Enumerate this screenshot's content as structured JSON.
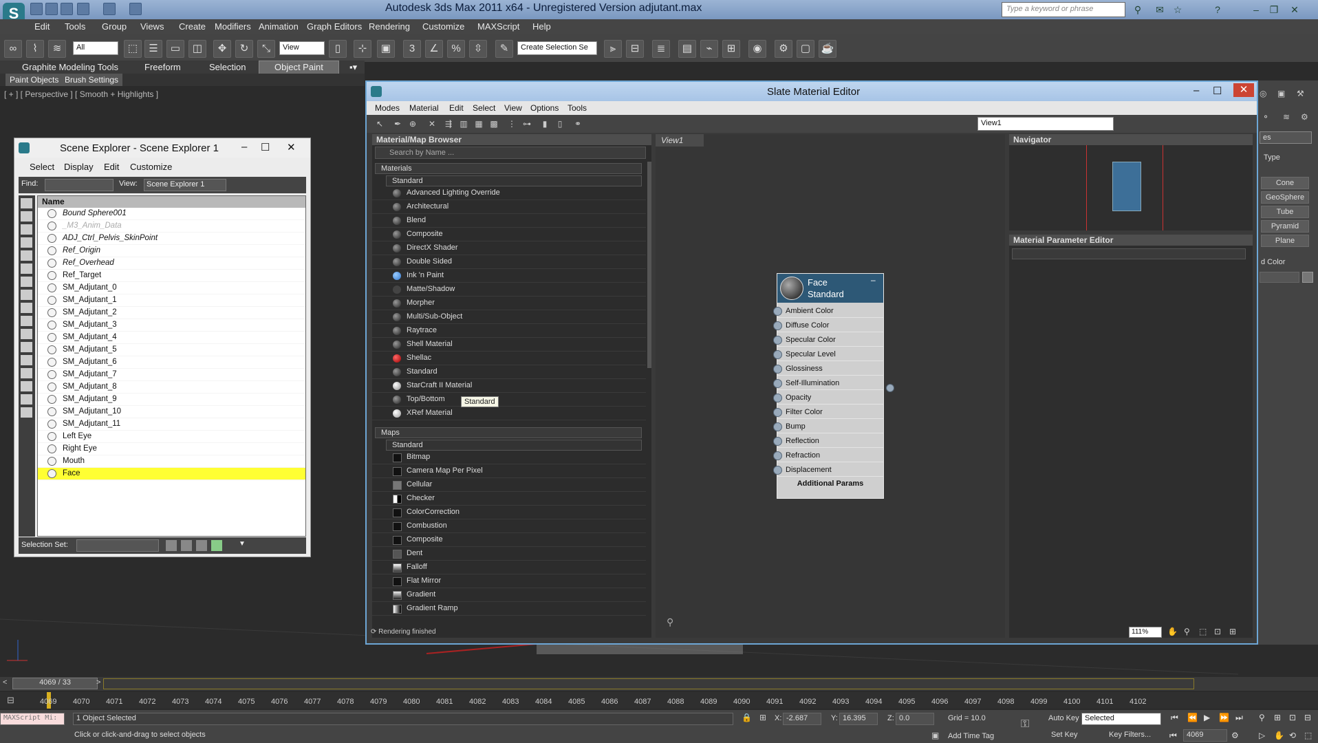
{
  "app": {
    "title": "Autodesk 3ds Max  2011 x64  -  Unregistered Version    adjutant.max",
    "search_placeholder": "Type a keyword or phrase"
  },
  "menu": [
    "Edit",
    "Tools",
    "Group",
    "Views",
    "Create",
    "Modifiers",
    "Animation",
    "Graph Editors",
    "Rendering",
    "Customize",
    "MAXScript",
    "Help"
  ],
  "toolbar": {
    "filter": "All",
    "refcoord": "View",
    "selset": "Create Selection Se"
  },
  "ribbon": {
    "tabs": [
      "Graphite Modeling Tools",
      "Freeform",
      "Selection",
      "Object Paint"
    ],
    "sub": [
      "Paint Objects",
      "Brush Settings"
    ]
  },
  "viewport": {
    "label": "[ + ] [ Perspective ] [ Smooth + Highlights ]"
  },
  "scene": {
    "title": "Scene Explorer - Scene Explorer 1",
    "menu": [
      "Select",
      "Display",
      "Edit",
      "Customize"
    ],
    "find_label": "Find:",
    "view_label": "View:",
    "view_value": "Scene Explorer 1",
    "col_name": "Name",
    "selset_label": "Selection Set:",
    "items": [
      "Bound Sphere001",
      "_M3_Anim_Data",
      "ADJ_Ctrl_Pelvis_SkinPoint",
      "Ref_Origin",
      "Ref_Overhead",
      "Ref_Target",
      "SM_Adjutant_0",
      "SM_Adjutant_1",
      "SM_Adjutant_2",
      "SM_Adjutant_3",
      "SM_Adjutant_4",
      "SM_Adjutant_5",
      "SM_Adjutant_6",
      "SM_Adjutant_7",
      "SM_Adjutant_8",
      "SM_Adjutant_9",
      "SM_Adjutant_10",
      "SM_Adjutant_11",
      "Left Eye",
      "Right Eye",
      "Mouth",
      "Face"
    ]
  },
  "slate": {
    "title": "Slate Material Editor",
    "menu": [
      "Modes",
      "Material",
      "Edit",
      "Select",
      "View",
      "Options",
      "Tools"
    ],
    "view_select": "View1",
    "browser_title": "Material/Map Browser",
    "search": "Search by Name ...",
    "materials_label": "Materials",
    "standard_label": "Standard",
    "maps_label": "Maps",
    "maps_standard_label": "Standard",
    "materials": [
      "Advanced Lighting Override",
      "Architectural",
      "Blend",
      "Composite",
      "DirectX Shader",
      "Double Sided",
      "Ink 'n Paint",
      "Matte/Shadow",
      "Morpher",
      "Multi/Sub-Object",
      "Raytrace",
      "Shell Material",
      "Shellac",
      "Standard",
      "StarCraft II Material",
      "Top/Bottom",
      "XRef Material"
    ],
    "maps": [
      "Bitmap",
      "Camera Map Per Pixel",
      "Cellular",
      "Checker",
      "ColorCorrection",
      "Combustion",
      "Composite",
      "Dent",
      "Falloff",
      "Flat Mirror",
      "Gradient",
      "Gradient Ramp"
    ],
    "tooltip": "Standard",
    "view_tab": "View1",
    "node": {
      "name": "Face",
      "type": "Standard",
      "slots": [
        "Ambient Color",
        "Diffuse Color",
        "Specular Color",
        "Specular Level",
        "Glossiness",
        "Self-Illumination",
        "Opacity",
        "Filter Color",
        "Bump",
        "Reflection",
        "Refraction",
        "Displacement"
      ],
      "footer": "Additional Params"
    },
    "navigator": "Navigator",
    "mpe": "Material Parameter Editor",
    "status": "Rendering finished",
    "zoom": "111%"
  },
  "cmd": {
    "items": [
      "Cone",
      "GeoSphere",
      "Tube",
      "Pyramid",
      "Plane"
    ],
    "type_label": "Type",
    "color_label": "d Color",
    "dropdown": "es"
  },
  "timeline": {
    "frame": "4069 / 33",
    "ticks": [
      "4069",
      "4070",
      "4071",
      "4072",
      "4073",
      "4074",
      "4075",
      "4076",
      "4077",
      "4078",
      "4079",
      "4080",
      "4081",
      "4082",
      "4083",
      "4084",
      "4085",
      "4086",
      "4087",
      "4088",
      "4089",
      "4090",
      "4091",
      "4092",
      "4093",
      "4094",
      "4095",
      "4096",
      "4097",
      "4098",
      "4099",
      "4100",
      "4101",
      "4102"
    ]
  },
  "status": {
    "script": "MAXScript Mi:",
    "selected": "1 Object Selected",
    "hint": "Click or click-and-drag to select objects",
    "x_label": "X:",
    "x": "-2.687",
    "y_label": "Y:",
    "y": "16.395",
    "z_label": "Z:",
    "z": "0.0",
    "grid": "Grid = 10.0",
    "auto_key": "Auto Key",
    "set_key": "Set Key",
    "selected_dd": "Selected",
    "key_filters": "Key Filters...",
    "add_time_tag": "Add Time Tag",
    "frame": "4069"
  }
}
